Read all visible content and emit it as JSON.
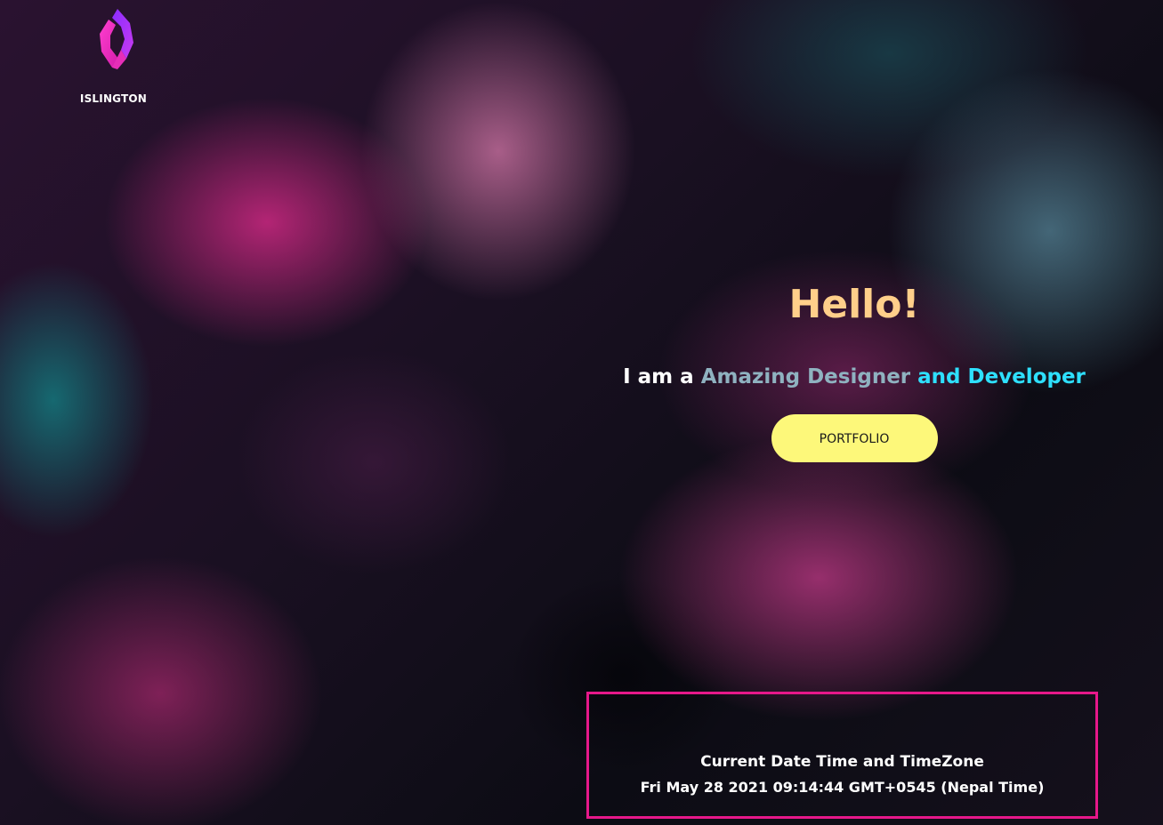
{
  "brand": {
    "name": "ISLINGTON",
    "logo_icon": "islington-ribbon-logo",
    "logo_colors": [
      "#ff2fc2",
      "#a52cff",
      "#c13be0"
    ]
  },
  "hero": {
    "greeting": "Hello!",
    "tagline_part1": "I am a",
    "tagline_part2": "Amazing Designer",
    "tagline_part3": "and Developer",
    "cta_label": "PORTFOLIO"
  },
  "datetime": {
    "heading": "Current Date Time and TimeZone",
    "value": "Fri May 28 2021 09:14:44 GMT+0545 (Nepal Time)"
  },
  "colors": {
    "greeting": "#ffcf8a",
    "tagline_accent_1": "#8fb2c0",
    "tagline_accent_2": "#2ee0ff",
    "cta_background": "#fdf87a",
    "datetime_border": "#e6188a"
  }
}
